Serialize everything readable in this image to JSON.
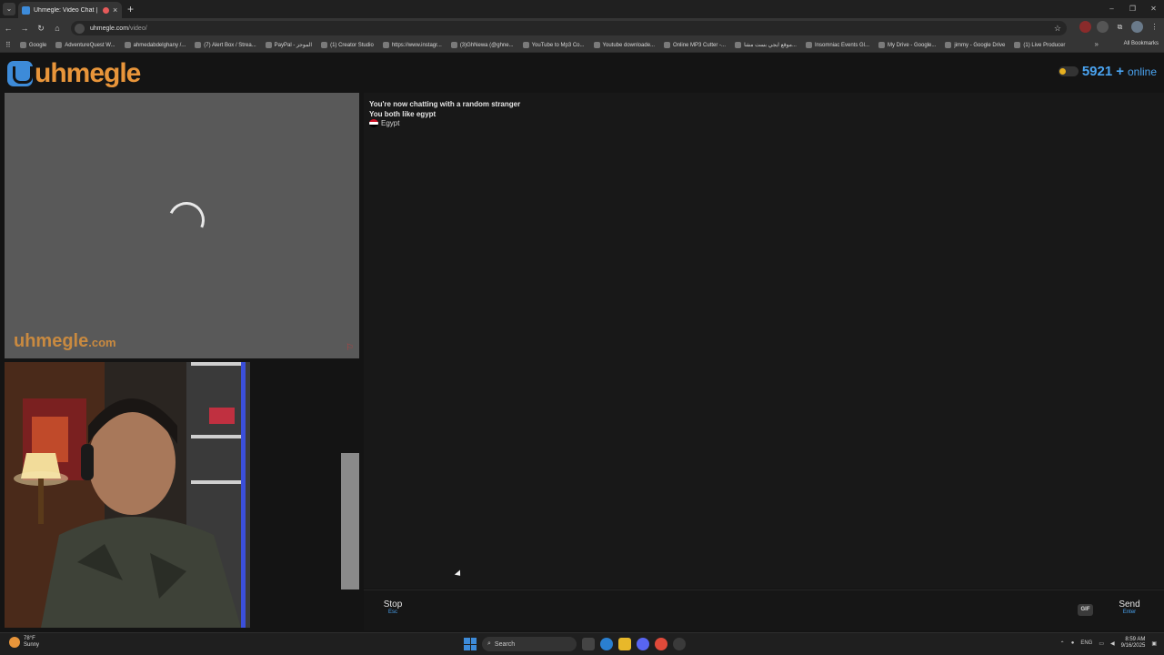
{
  "browser": {
    "tab_title": "Uhmegle: Video Chat | Om",
    "tab_close": "×",
    "new_tab": "+",
    "tab_list": "⌄",
    "window_controls": {
      "minimize": "–",
      "maximize": "❐",
      "close": "✕"
    },
    "nav": {
      "back": "←",
      "forward": "→",
      "reload": "↻",
      "home": "⌂"
    },
    "url_host": "uhmegle.com",
    "url_path": "/video/",
    "bookmark_star": "☆",
    "extensions_icon": "⧉",
    "menu_icon": "⋮",
    "bookmarks_overflow": "»",
    "apps_icon": "⠿",
    "bookmarks": [
      "Google",
      "AdventureQuest W...",
      "ahmedabdelghany /...",
      "(7) Alert Box / Strea...",
      "PayPal - الموجز",
      "(1) Creator Studio",
      "https://www.instagr...",
      "(3)GhNewa (@ghne...",
      "YouTube to Mp3 Co...",
      "Youtube downloade...",
      "Online MP3 Cutter -...",
      "موقع ايجي بست مشا...",
      "Insomniac Events Gl...",
      "My Drive - Google...",
      "jimmy - Google Drive",
      "(1) Live Producer"
    ],
    "all_bookmarks": "All Bookmarks"
  },
  "site": {
    "logo_text": "uhmegle",
    "online_count": "5921",
    "online_suffix": "+",
    "online_label": "online",
    "watermark_name": "uhmegle",
    "watermark_domain": ".com",
    "report_icon": "⚐"
  },
  "chat": {
    "messages": [
      "You're now chatting with a random stranger",
      "You both like egypt"
    ],
    "country": "Egypt",
    "stop_label": "Stop",
    "stop_key": "Esc",
    "gif_label": "GIF",
    "send_label": "Send",
    "send_key": "Enter",
    "input_value": ""
  },
  "taskbar": {
    "temperature": "78°F",
    "condition": "Sunny",
    "search_label": "Search",
    "language": "ENG",
    "time": "8:59 AM",
    "date": "9/16/2025"
  },
  "colors": {
    "brand_blue": "#3d8bd9",
    "brand_orange": "#e8953a",
    "online_blue": "#4aa3f0"
  }
}
